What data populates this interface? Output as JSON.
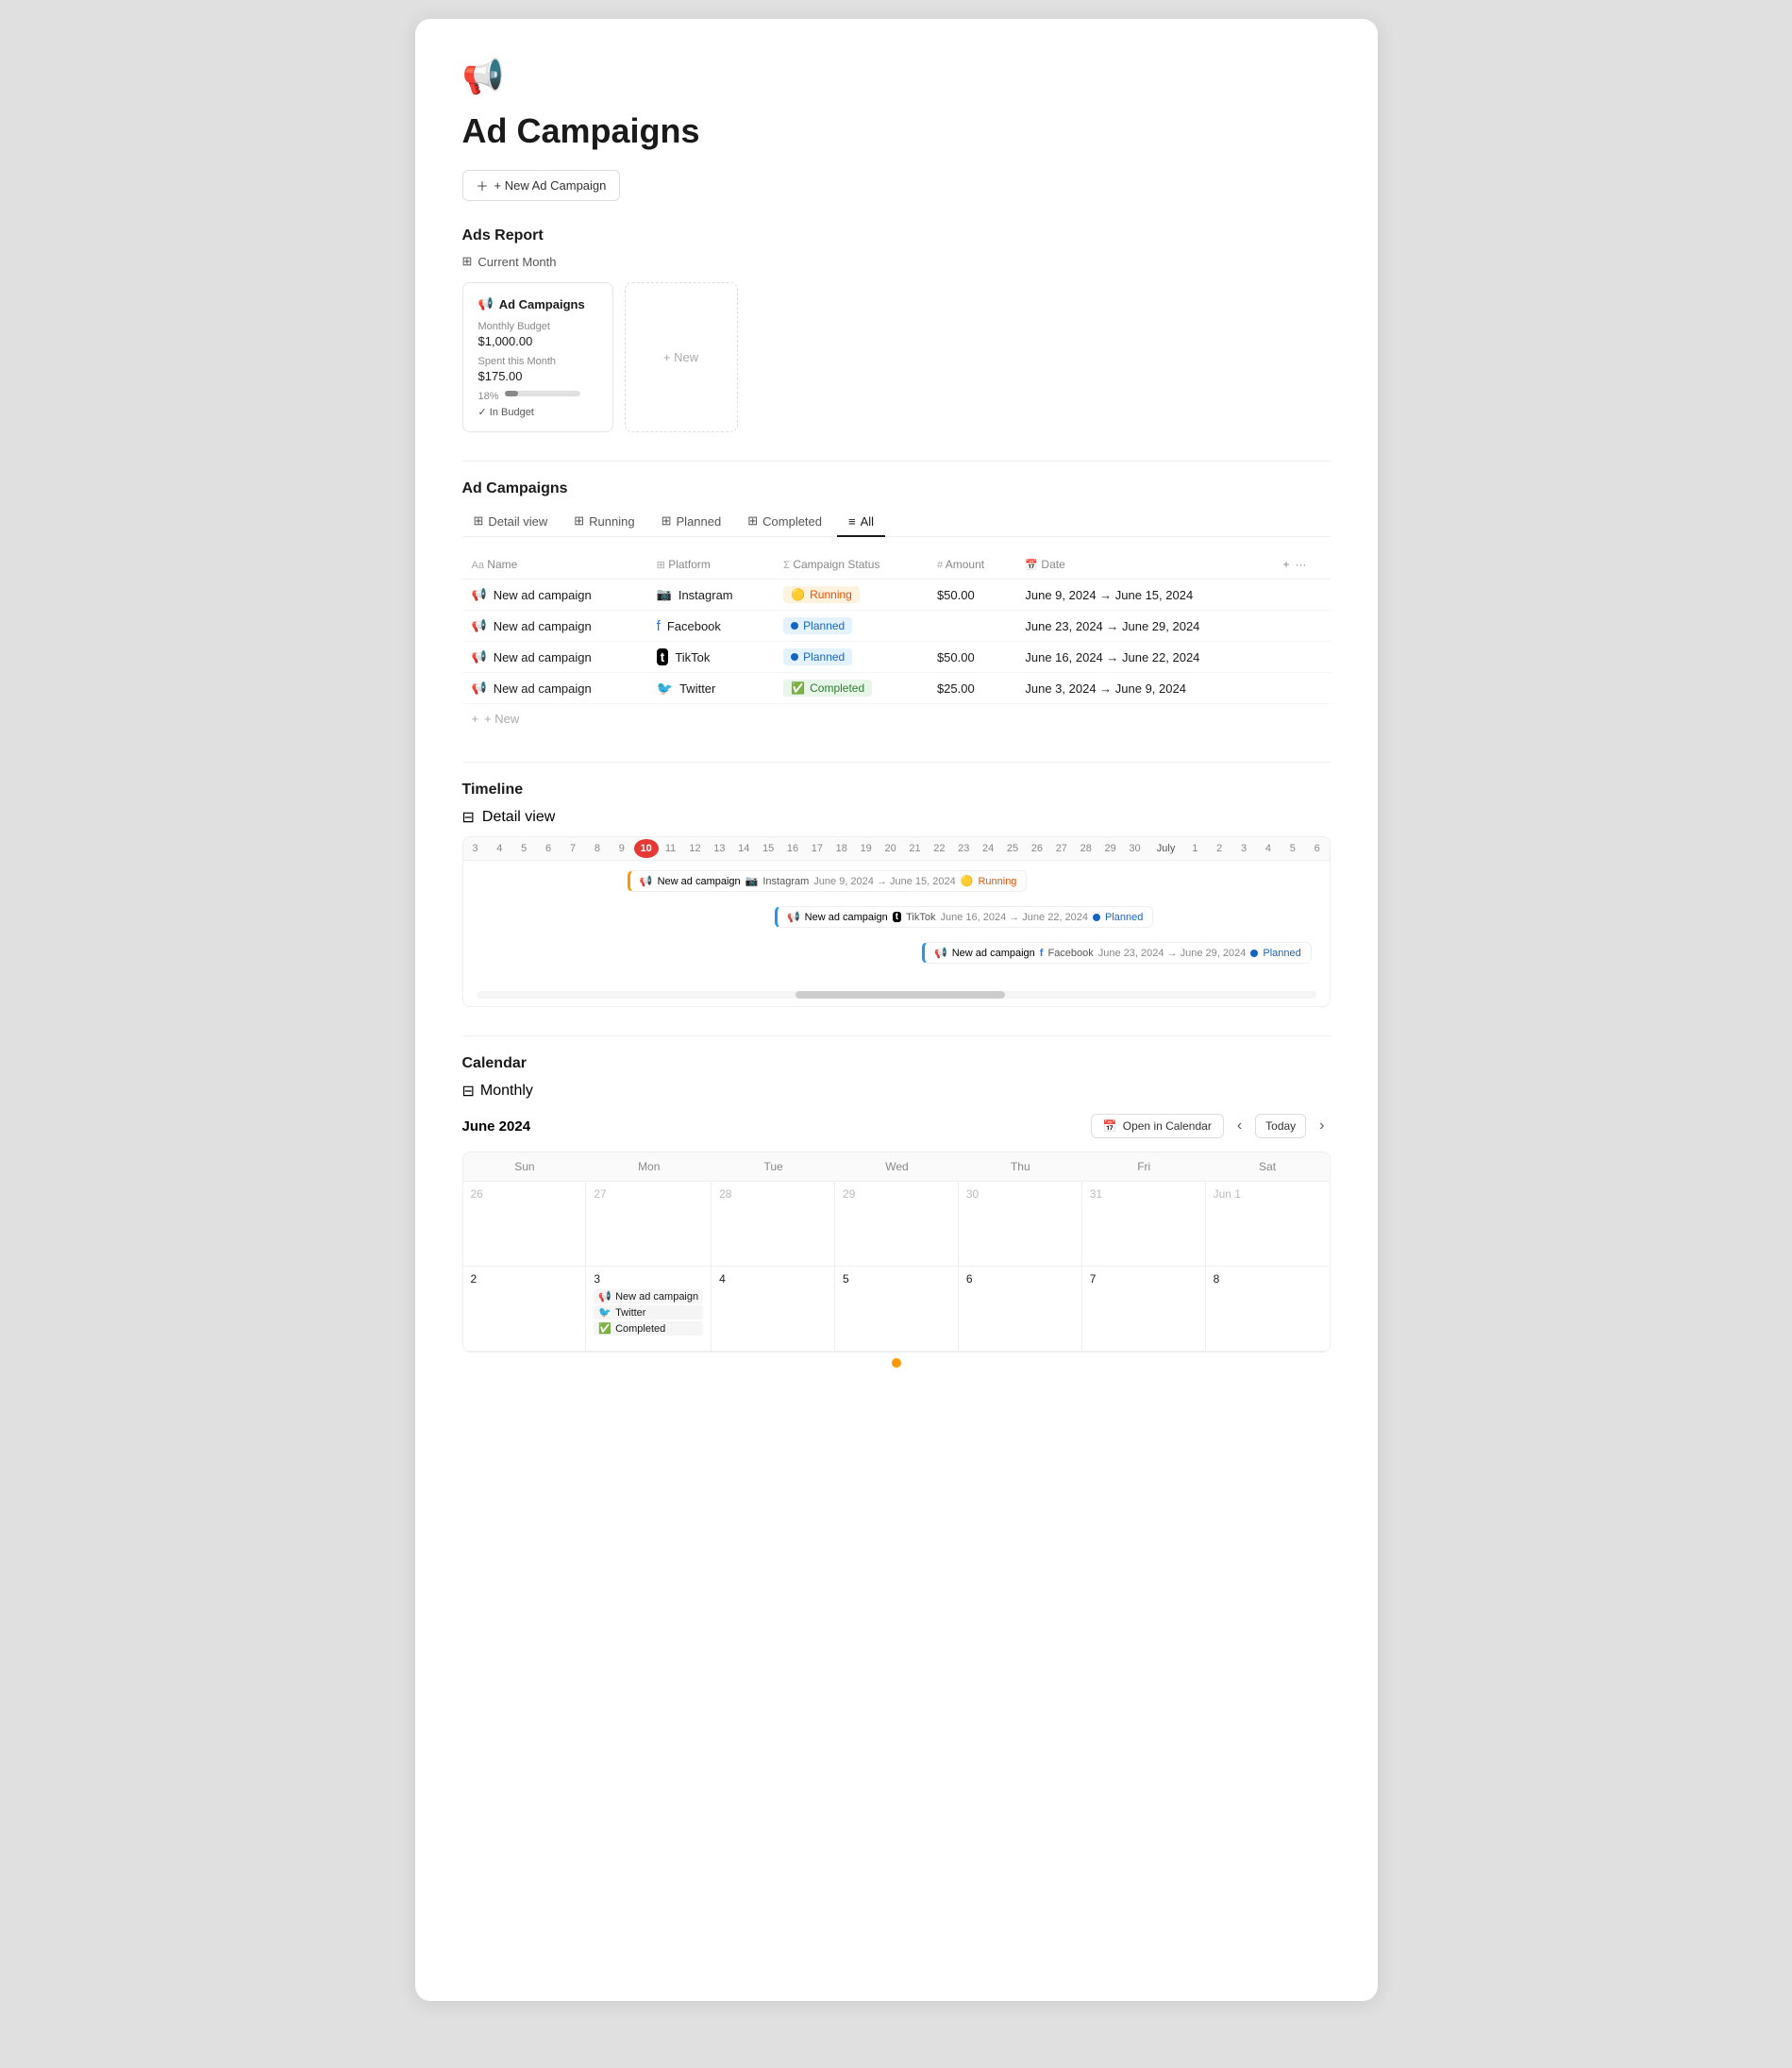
{
  "page": {
    "icon": "📢",
    "title": "Ad Campaigns",
    "new_button": "+ New Ad Campaign"
  },
  "ads_report": {
    "section_title": "Ads Report",
    "filter_icon": "⊞",
    "filter_label": "Current Month",
    "card": {
      "title": "Ad Campaigns",
      "monthly_budget_label": "Monthly Budget",
      "monthly_budget_value": "$1,000.00",
      "spent_label": "Spent this Month",
      "spent_value": "$175.00",
      "progress_pct": 18,
      "progress_label": "18%",
      "status": "✓ In Budget"
    },
    "new_card_label": "+ New"
  },
  "ad_campaigns": {
    "section_title": "Ad Campaigns",
    "tabs": [
      {
        "label": "Detail view",
        "icon": "⊞",
        "active": false
      },
      {
        "label": "Running",
        "icon": "⊞",
        "active": false
      },
      {
        "label": "Planned",
        "icon": "⊞",
        "active": false
      },
      {
        "label": "Completed",
        "icon": "⊞",
        "active": false
      },
      {
        "label": "All",
        "icon": "≡",
        "active": true
      }
    ],
    "columns": [
      "Name",
      "Platform",
      "Campaign Status",
      "Amount",
      "Date"
    ],
    "rows": [
      {
        "name": "New ad campaign",
        "platform": "Instagram",
        "platform_emoji": "📷",
        "status": "Running",
        "status_class": "status-running",
        "status_dot": "🟡",
        "amount": "$50.00",
        "date": "June 9, 2024 → June 15, 2024"
      },
      {
        "name": "New ad campaign",
        "platform": "Facebook",
        "platform_emoji": "🔵",
        "status": "Planned",
        "status_class": "status-planned",
        "status_dot": "🔵",
        "amount": "",
        "date": "June 23, 2024 → June 29, 2024"
      },
      {
        "name": "New ad campaign",
        "platform": "TikTok",
        "platform_emoji": "⬛",
        "status": "Planned",
        "status_class": "status-planned",
        "status_dot": "🔵",
        "amount": "$50.00",
        "date": "June 16, 2024 → June 22, 2024"
      },
      {
        "name": "New ad campaign",
        "platform": "Twitter",
        "platform_emoji": "🐦",
        "status": "Completed",
        "status_class": "status-completed",
        "status_dot": "✅",
        "amount": "$25.00",
        "date": "June 3, 2024 → June 9, 2024"
      }
    ],
    "add_row_label": "+ New"
  },
  "timeline": {
    "section_title": "Timeline",
    "detail_view_label": "Detail view",
    "month_label": "July",
    "dates": [
      "3",
      "4",
      "5",
      "6",
      "7",
      "8",
      "9",
      "10",
      "11",
      "12",
      "13",
      "14",
      "15",
      "16",
      "17",
      "18",
      "19",
      "20",
      "21",
      "22",
      "23",
      "24",
      "25",
      "26",
      "27",
      "28",
      "29",
      "30",
      "1",
      "2",
      "3",
      "4",
      "5",
      "6"
    ],
    "today_date": "10",
    "bars": [
      {
        "campaign": "New ad campaign",
        "platform": "Instagram",
        "date_range": "June 9, 2024 → June 15, 2024",
        "status": "Running",
        "status_class": "status-running",
        "left_pct": 18,
        "width_pct": 22
      },
      {
        "campaign": "New ad campaign",
        "platform": "TikTok",
        "date_range": "June 16, 2024 → June 22, 2024",
        "status": "Planned",
        "status_class": "status-planned",
        "left_pct": 36,
        "width_pct": 22
      },
      {
        "campaign": "New ad campaign",
        "platform": "Facebook",
        "date_range": "June 23, 2024 → June 29, 2024",
        "status": "Planned",
        "status_class": "status-planned",
        "left_pct": 55,
        "width_pct": 24
      }
    ]
  },
  "calendar": {
    "section_title": "Calendar",
    "view_label": "Monthly",
    "month_year": "June 2024",
    "open_btn": "Open in Calendar",
    "today_btn": "Today",
    "day_headers": [
      "Sun",
      "Mon",
      "Tue",
      "Wed",
      "Thu",
      "Fri",
      "Sat"
    ],
    "weeks": [
      [
        {
          "date": "26",
          "current": false,
          "events": []
        },
        {
          "date": "27",
          "current": false,
          "events": []
        },
        {
          "date": "28",
          "current": false,
          "events": []
        },
        {
          "date": "29",
          "current": false,
          "events": []
        },
        {
          "date": "30",
          "current": false,
          "events": []
        },
        {
          "date": "31",
          "current": false,
          "events": []
        },
        {
          "date": "Jun 1",
          "current": false,
          "events": []
        }
      ],
      [
        {
          "date": "2",
          "current": true,
          "events": []
        },
        {
          "date": "3",
          "current": true,
          "events": [
            {
              "icon": "📢",
              "text": "New ad campaign"
            },
            {
              "platform": "Twitter",
              "dot": "blue"
            },
            {
              "status": "Completed",
              "check": true
            }
          ]
        },
        {
          "date": "4",
          "current": true,
          "events": []
        },
        {
          "date": "5",
          "current": true,
          "events": []
        },
        {
          "date": "6",
          "current": true,
          "events": []
        },
        {
          "date": "7",
          "current": true,
          "events": []
        },
        {
          "date": "8",
          "current": true,
          "events": []
        }
      ]
    ]
  }
}
